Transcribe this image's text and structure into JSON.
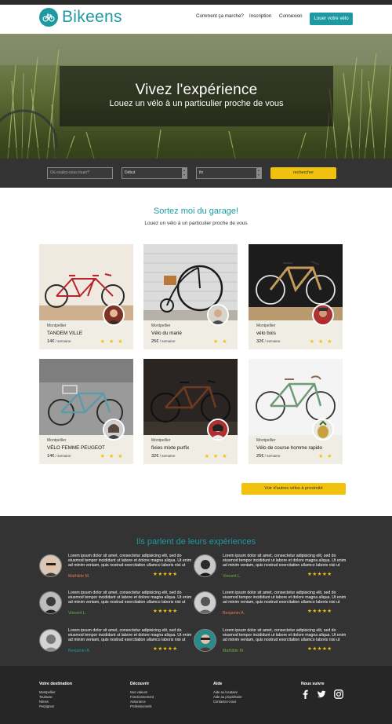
{
  "header": {
    "logo_text": "Bikeens",
    "nav": [
      {
        "label": "Comment ça marche?"
      },
      {
        "label": "Inscription"
      },
      {
        "label": "Connexion"
      }
    ],
    "cta_label": "Louer votre vélo",
    "brand_color": "#1d9aa1"
  },
  "hero": {
    "title": "Vivez l'expérience",
    "subtitle": "Louez un vélo à un particulier proche de vous"
  },
  "search": {
    "location_placeholder": "Où voulez-vous louer?",
    "start_value": "Début",
    "end_value": "fin",
    "button_label": "rechercher"
  },
  "section": {
    "title": "Sortez moi du garage!",
    "subtitle": "Louez un vélo à un particulier proche de vous"
  },
  "cards": [
    {
      "city": "Montpellier",
      "name": "TANDEM VILLE",
      "price": "14€",
      "unit": " / semaine",
      "stars": "★ ★ ★"
    },
    {
      "city": "Montpellier",
      "name": "Vélo du marié",
      "price": "25€",
      "unit": " / semaine",
      "stars": "★ ★"
    },
    {
      "city": "Montpellier",
      "name": "vélo bois",
      "price": "32€",
      "unit": " / semaine",
      "stars": "★ ★ ★"
    },
    {
      "city": "Montpellier",
      "name": "VÉLO FEMME PEUGEOT",
      "price": "14€",
      "unit": " / semaine",
      "stars": "★ ★ ★"
    },
    {
      "city": "Montpellier",
      "name": "fixies mixte purfix",
      "price": "32€",
      "unit": " / semaine",
      "stars": "★ ★ ★"
    },
    {
      "city": "Montpellier",
      "name": "Vélo de course homme rapido",
      "price": "25€",
      "unit": " / semaine",
      "stars": "★ ★"
    }
  ],
  "more_button": "Voir d'autres vélos à proximité",
  "testimonials": {
    "title": "Ils parlent de leurs expériences",
    "quote": "Lorem ipsum dolor sit amet, consectetur adipisicing elit, sed do eiusmod tempor incididunt ut labore et dolore magna aliqua. Ut enim ad minim veniam, quis nostrud exercitation ullamco laboris nisi ut",
    "stars": "★★★★★",
    "items": [
      {
        "name": "Mathilde M.",
        "name_color": "#e07a5a"
      },
      {
        "name": "Vincent L.",
        "name_color": "#6ab04c"
      },
      {
        "name": "Vincent L.",
        "name_color": "#6ab04c"
      },
      {
        "name": "Benjamin A.",
        "name_color": "#e07a5a"
      },
      {
        "name": "Benjamin A.",
        "name_color": "#1d9aa1"
      },
      {
        "name": "Mathilde M.",
        "name_color": "#6ab04c"
      }
    ]
  },
  "footer": {
    "col1": {
      "title": "Votre destination",
      "links": [
        "Montpellier",
        "Toulouse",
        "Nimes",
        "Perpignan"
      ]
    },
    "col2": {
      "title": "Découvrir",
      "links": [
        "Nos valeurs",
        "Fonctionnement",
        "Assurance",
        "Professionnels"
      ]
    },
    "col3": {
      "title": "Aide",
      "links": [
        "Aide au locataire",
        "Aide au propriétaire",
        "Contactez-nous"
      ]
    },
    "col4": {
      "title": "Nous suivre",
      "social": [
        "facebook-icon",
        "twitter-icon",
        "instagram-icon"
      ]
    }
  }
}
